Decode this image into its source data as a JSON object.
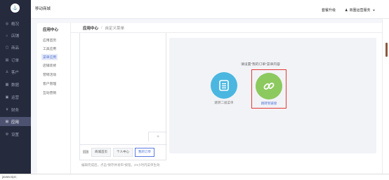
{
  "topbar": {
    "brand": "移动商城",
    "upgrade_label": "套餐升级",
    "account_label": "商圈运营服务"
  },
  "sidebar": {
    "items": [
      {
        "label": "概况",
        "icon": "dashboard-icon"
      },
      {
        "label": "店铺",
        "icon": "store-icon"
      },
      {
        "label": "商品",
        "icon": "goods-icon"
      },
      {
        "label": "订单",
        "icon": "order-icon"
      },
      {
        "label": "客户",
        "icon": "customer-icon"
      },
      {
        "label": "数据",
        "icon": "data-icon"
      },
      {
        "label": "运营",
        "icon": "operation-icon"
      },
      {
        "label": "财务",
        "icon": "finance-icon"
      },
      {
        "label": "应用",
        "icon": "app-icon",
        "active": true
      },
      {
        "label": "设置",
        "icon": "settings-icon"
      }
    ]
  },
  "subnav": {
    "title": "应用中心",
    "items": [
      "应用首页",
      "工具应用",
      "菜单应用",
      "店铺装修",
      "营销活动",
      "客户管理",
      "互动营销"
    ],
    "active_index": 2
  },
  "breadcrumb": {
    "root": "应用中心",
    "separator": "/",
    "current": "自定义菜单"
  },
  "phone": {
    "add_symbol": "+",
    "tabs": [
      "商城首页",
      "个人中心",
      "我的订单"
    ],
    "selected_tab_index": 2
  },
  "hint": "编辑完成后，点击“保存并发布”按钮，24小时内菜单生效",
  "panel": {
    "title": "请设置“我的订单”菜单内容",
    "options": [
      {
        "label": "跳转二级菜单",
        "icon": "document-icon",
        "color": "#4bb7e0"
      },
      {
        "label": "跳转到链接",
        "icon": "link-icon",
        "color": "#8cc95e",
        "selected": true
      }
    ]
  },
  "statusbar": {
    "text": "javascript:;"
  },
  "colors": {
    "sidebar_bg": "#252a3d",
    "accent": "#4a6fd6",
    "highlight_border": "#e53935"
  }
}
